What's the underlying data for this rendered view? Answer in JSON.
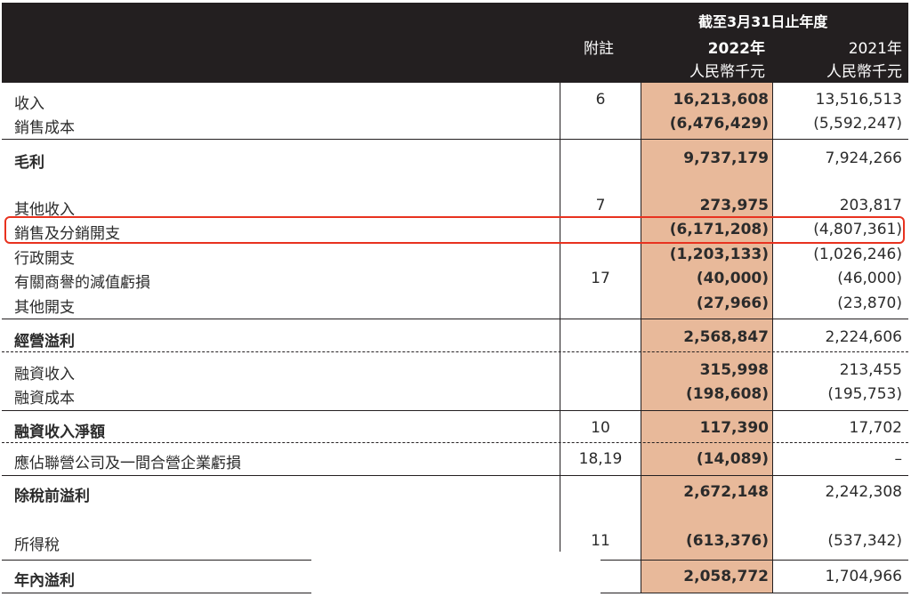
{
  "header": {
    "period": "截至3月31日止年度",
    "note_label": "附註",
    "cur_year": "2022年",
    "prev_year": "2021年",
    "cur_unit": "人民幣千元",
    "prev_unit": "人民幣千元"
  },
  "rows": [
    {
      "label": "收入",
      "note": "6",
      "cur": "16,213,608",
      "prev": "13,516,513"
    },
    {
      "label": "銷售成本",
      "note": "",
      "cur": "(6,476,429)",
      "prev": "(5,592,247)"
    },
    {
      "label": "毛利",
      "note": "",
      "cur": "9,737,179",
      "prev": "7,924,266"
    },
    {
      "label": "其他收入",
      "note": "7",
      "cur": "273,975",
      "prev": "203,817"
    },
    {
      "label": "銷售及分銷開支",
      "note": "",
      "cur": "(6,171,208)",
      "prev": "(4,807,361)"
    },
    {
      "label": "行政開支",
      "note": "",
      "cur": "(1,203,133)",
      "prev": "(1,026,246)"
    },
    {
      "label": "有關商譽的減值虧損",
      "note": "17",
      "cur": "(40,000)",
      "prev": "(46,000)"
    },
    {
      "label": "其他開支",
      "note": "",
      "cur": "(27,966)",
      "prev": "(23,870)"
    },
    {
      "label": "經營溢利",
      "note": "",
      "cur": "2,568,847",
      "prev": "2,224,606"
    },
    {
      "label": "融資收入",
      "note": "",
      "cur": "315,998",
      "prev": "213,455"
    },
    {
      "label": "融資成本",
      "note": "",
      "cur": "(198,608)",
      "prev": "(195,753)"
    },
    {
      "label": "融資收入淨額",
      "note": "10",
      "cur": "117,390",
      "prev": "17,702"
    },
    {
      "label": "應佔聯營公司及一間合營企業虧損",
      "note": "18,19",
      "cur": "(14,089)",
      "prev": "–"
    },
    {
      "label": "除稅前溢利",
      "note": "",
      "cur": "2,672,148",
      "prev": "2,242,308"
    },
    {
      "label": "所得稅",
      "note": "11",
      "cur": "(613,376)",
      "prev": "(537,342)"
    },
    {
      "label": "年內溢利",
      "note": "",
      "cur": "2,058,772",
      "prev": "1,704,966"
    }
  ],
  "colors": {
    "header_bg": "#231f20",
    "current_year_bg": "#e8b99a",
    "highlight": "#e8321f"
  }
}
